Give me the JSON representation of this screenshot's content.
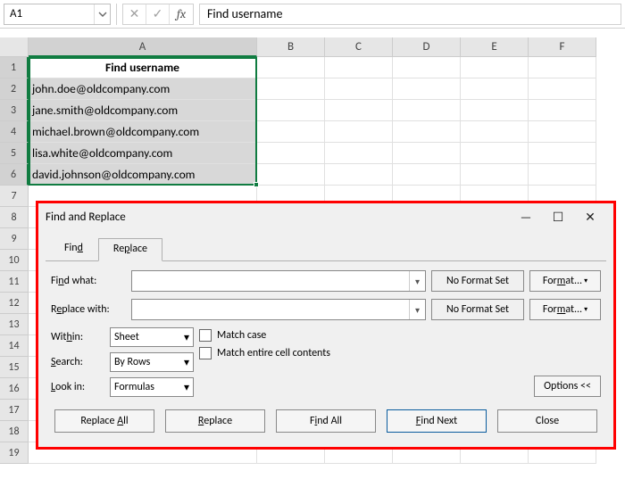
{
  "namebox": {
    "value": "A1"
  },
  "formula_bar": {
    "value": "Find username"
  },
  "columns": [
    "A",
    "B",
    "C",
    "D",
    "E",
    "F"
  ],
  "rows": [
    {
      "n": "1",
      "a": "Find username"
    },
    {
      "n": "2",
      "a": "john.doe@oldcompany.com"
    },
    {
      "n": "3",
      "a": "jane.smith@oldcompany.com"
    },
    {
      "n": "4",
      "a": "michael.brown@oldcompany.com"
    },
    {
      "n": "5",
      "a": "lisa.white@oldcompany.com"
    },
    {
      "n": "6",
      "a": "david.johnson@oldcompany.com"
    }
  ],
  "extra_rows": [
    "7",
    "8",
    "9",
    "10",
    "11",
    "12",
    "13",
    "14",
    "15",
    "16",
    "17",
    "18",
    "19"
  ],
  "dialog": {
    "title": "Find and Replace",
    "tabs": {
      "find": "Find",
      "replace": "Replace"
    },
    "find_what_label": "Find what:",
    "replace_with_label": "Replace with:",
    "find_what_value": "",
    "replace_with_value": "",
    "no_format": "No Format Set",
    "format_btn": "Format...",
    "within_label": "Within:",
    "within_value": "Sheet",
    "search_label": "Search:",
    "search_value": "By Rows",
    "lookin_label": "Look in:",
    "lookin_value": "Formulas",
    "match_case": "Match case",
    "match_entire": "Match entire cell contents",
    "options_btn": "Options <<",
    "buttons": {
      "replace_all": "Replace All",
      "replace": "Replace",
      "find_all": "Find All",
      "find_next": "Find Next",
      "close": "Close"
    }
  }
}
